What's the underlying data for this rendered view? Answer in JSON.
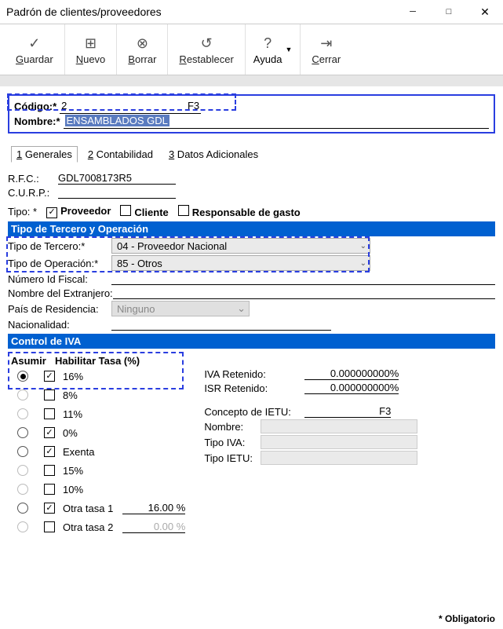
{
  "window": {
    "title": "Padrón de clientes/proveedores"
  },
  "toolbar": {
    "guardar": "Guardar",
    "nuevo": "Nuevo",
    "borrar": "Borrar",
    "restablecer": "Restablecer",
    "ayuda": "Ayuda",
    "cerrar": "Cerrar"
  },
  "id": {
    "codigo_label": "Código:*",
    "codigo_value": "2",
    "codigo_hint": "F3",
    "nombre_label": "Nombre:*",
    "nombre_value": "ENSAMBLADOS GDL"
  },
  "tabs": {
    "generales": "1 Generales",
    "contabilidad": "2 Contabilidad",
    "datos_adicionales": "3 Datos Adicionales"
  },
  "generales": {
    "rfc_label": "R.F.C.:",
    "rfc_value": "GDL7008173R5",
    "curp_label": "C.U.R.P.:",
    "tipo_label": "Tipo: *",
    "proveedor": "Proveedor",
    "cliente": "Cliente",
    "responsable": "Responsable de gasto",
    "sect_tercero": "Tipo de Tercero y Operación",
    "tipo_tercero_label": "Tipo de Tercero:*",
    "tipo_tercero_value": "04 - Proveedor Nacional",
    "tipo_operacion_label": "Tipo de Operación:*",
    "tipo_operacion_value": "85 - Otros",
    "numero_id_fiscal": "Número Id Fiscal:",
    "nombre_extranjero": "Nombre del Extranjero:",
    "pais_residencia_label": "País de Residencia:",
    "pais_residencia_value": "Ninguno",
    "nacionalidad": "Nacionalidad:",
    "sect_iva": "Control de IVA",
    "hdr_asumir": "Asumir",
    "hdr_habilitar": "Habilitar",
    "hdr_tasa": "Tasa (%)",
    "tasa_16": "16%",
    "tasa_8": "8%",
    "tasa_11": "11%",
    "tasa_0": "0%",
    "tasa_exenta": "Exenta",
    "tasa_15": "15%",
    "tasa_10": "10%",
    "tasa_otra1": "Otra tasa 1",
    "tasa_otra2": "Otra tasa 2",
    "otra1_val": "16.00 %",
    "otra2_val": "0.00 %",
    "iva_retenido_label": "IVA Retenido:",
    "iva_retenido_value": "0.000000000%",
    "isr_retenido_label": "ISR Retenido:",
    "isr_retenido_value": "0.000000000%",
    "concepto_ietu_label": "Concepto de IETU:",
    "concepto_ietu_hint": "F3",
    "ietu_nombre": "Nombre:",
    "ietu_tipo_iva": "Tipo IVA:",
    "ietu_tipo_ietu": "Tipo IETU:"
  },
  "footer": {
    "obligatorio": "* Obligatorio"
  }
}
